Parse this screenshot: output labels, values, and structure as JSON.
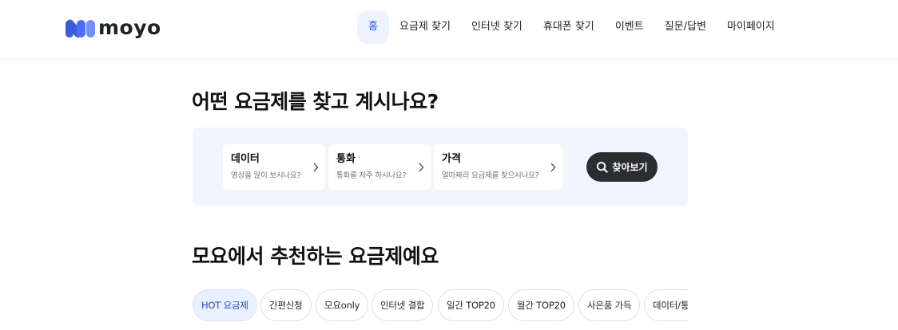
{
  "brand": {
    "name": "moyo",
    "accent": "#3b5bdb",
    "logo_icon": "moyo-logo-mark"
  },
  "nav": {
    "items": [
      {
        "label": "홈",
        "active": true
      },
      {
        "label": "요금제 찾기"
      },
      {
        "label": "인터넷 찾기"
      },
      {
        "label": "휴대폰 찾기"
      },
      {
        "label": "이벤트"
      },
      {
        "label": "질문/답변"
      },
      {
        "label": "마이페이지"
      }
    ]
  },
  "finder": {
    "heading": "어떤 요금제를 찾고 계시나요?",
    "cards": [
      {
        "title": "데이터",
        "description": "영상을 많이 보시나요?",
        "icon": "chevron-right-icon"
      },
      {
        "title": "통화",
        "description": "통화를 자주 하시나요?",
        "icon": "chevron-right-icon"
      },
      {
        "title": "가격",
        "description": "얼마짜리 요금제를 찾으시나요?",
        "icon": "chevron-right-icon"
      }
    ],
    "search_button": {
      "label": "찾아보기",
      "icon": "search-icon"
    }
  },
  "recommend": {
    "heading": "모요에서 추천하는 요금제예요",
    "chips": [
      {
        "label": "HOT 요금제",
        "active": true
      },
      {
        "label": "간편신청"
      },
      {
        "label": "모요only"
      },
      {
        "label": "인터넷 결합"
      },
      {
        "label": "일간 TOP20"
      },
      {
        "label": "월간 TOP20"
      },
      {
        "label": "사은품 가득"
      },
      {
        "label": "데이터/통화"
      }
    ]
  }
}
